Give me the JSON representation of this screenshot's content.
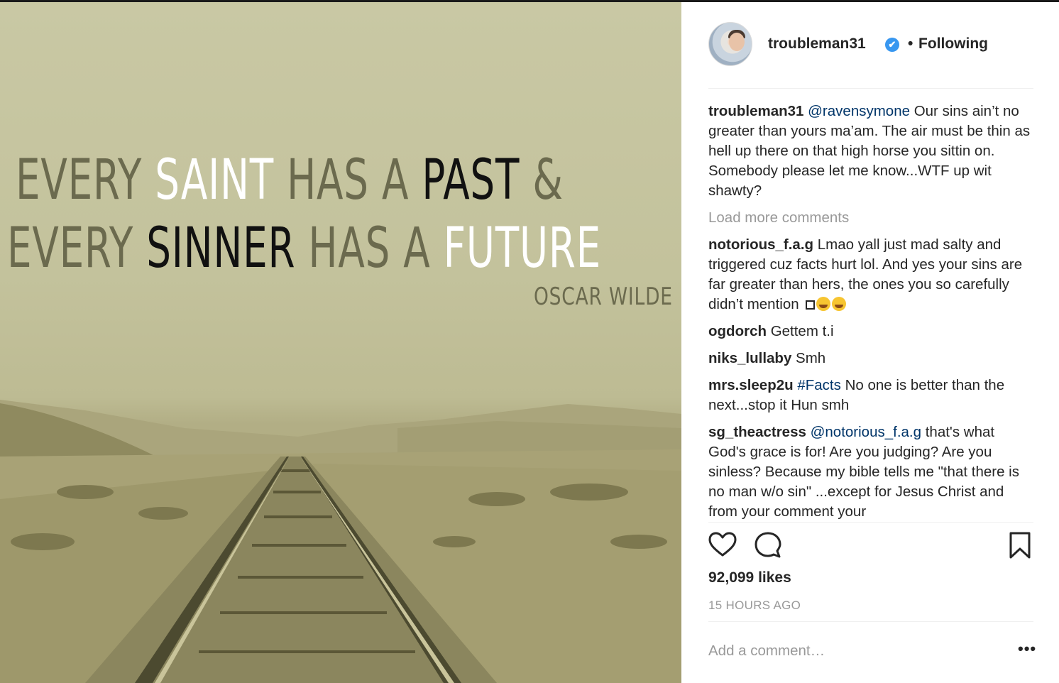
{
  "image": {
    "quote_line1": [
      {
        "text": "EVERY ",
        "tone": "g"
      },
      {
        "text": "SAINT",
        "tone": "w"
      },
      {
        "text": " HAS A ",
        "tone": "g"
      },
      {
        "text": "PAST",
        "tone": "k"
      },
      {
        "text": " &",
        "tone": "g"
      }
    ],
    "quote_line2": [
      {
        "text": "EVERY ",
        "tone": "g"
      },
      {
        "text": "SINNER",
        "tone": "k"
      },
      {
        "text": " HAS A ",
        "tone": "g"
      },
      {
        "text": "FUTURE",
        "tone": "w"
      }
    ],
    "attribution": "OSCAR WILDE"
  },
  "post_header": {
    "username": "troubleman31",
    "verified_icon": "✔",
    "separator": "•",
    "follow_status": "Following"
  },
  "caption": {
    "username": "troubleman31",
    "mention": "@ravensymone",
    "text": " Our sins ain’t no greater than yours ma’am. The air must be thin as hell up there on that high horse you sittin on. Somebody please let me know...WTF up wit shawty?"
  },
  "load_more": "Load more comments",
  "comments": [
    {
      "username": "notorious_f.a.g",
      "mention": "",
      "text": " Lmao yall just mad salty and triggered cuz facts hurt lol. And yes your sins are far greater than hers, the ones you so carefully didn’t mention",
      "has_emoji": true
    },
    {
      "username": "ogdorch",
      "mention": "",
      "text": " Gettem t.i",
      "has_emoji": false
    },
    {
      "username": "niks_lullaby",
      "mention": "",
      "text": " Smh",
      "has_emoji": false
    },
    {
      "username": "mrs.sleep2u",
      "mention": "#Facts",
      "text": " No one is better than the next...stop it Hun smh",
      "has_emoji": false
    },
    {
      "username": "sg_theactress",
      "mention": "@notorious_f.a.g",
      "text": " that's what God's grace is for! Are you judging? Are you sinless? Because my bible tells me \"that there is no man w/o sin\" ...except for Jesus Christ and from your comment your",
      "has_emoji": false
    }
  ],
  "actions": {
    "like_icon": "heart-icon",
    "comment_icon": "comment-bubble-icon",
    "save_icon": "bookmark-icon"
  },
  "likes": "92,099 likes",
  "timestamp": "15 HOURS AGO",
  "add_comment_placeholder": "Add a comment…",
  "more_options": "•••",
  "colors": {
    "link": "#003569",
    "verified": "#3897f0",
    "muted": "#999999",
    "text": "#262626"
  }
}
